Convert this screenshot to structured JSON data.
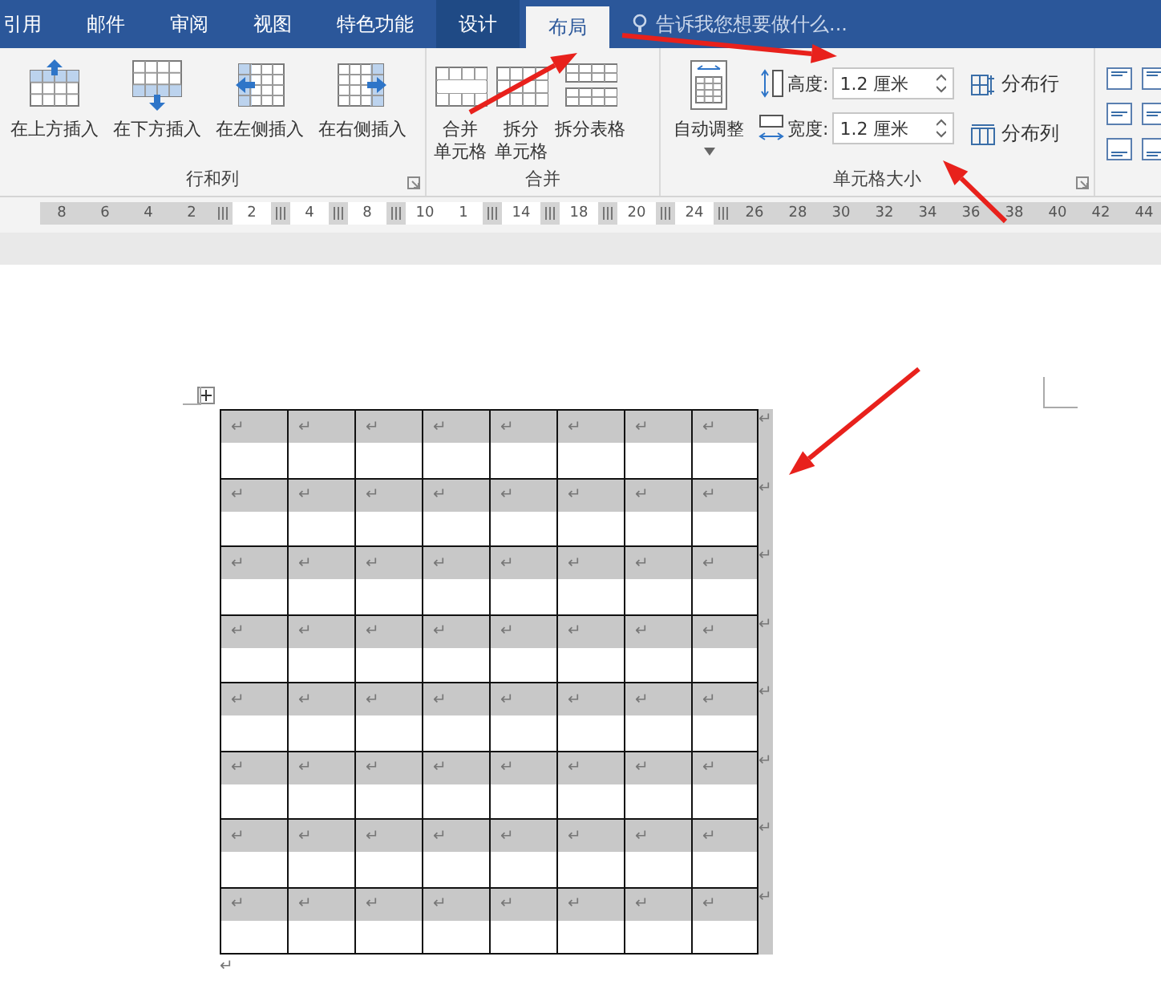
{
  "tabs": [
    {
      "label": "引用",
      "selected": false,
      "kind": "normal"
    },
    {
      "label": "邮件",
      "selected": false,
      "kind": "normal"
    },
    {
      "label": "审阅",
      "selected": false,
      "kind": "normal"
    },
    {
      "label": "视图",
      "selected": false,
      "kind": "normal"
    },
    {
      "label": "特色功能",
      "selected": false,
      "kind": "normal"
    },
    {
      "label": "设计",
      "selected": false,
      "kind": "contextual"
    },
    {
      "label": "布局",
      "selected": true,
      "kind": "contextual"
    }
  ],
  "tell_me": {
    "placeholder": "告诉我您想要做什么..."
  },
  "groups": [
    {
      "label": "行和列",
      "launcher": true,
      "items": [
        {
          "kind": "big-button",
          "label": "在上方插入"
        },
        {
          "kind": "big-button",
          "label": "在下方插入"
        },
        {
          "kind": "big-button",
          "label": "在左侧插入"
        },
        {
          "kind": "big-button",
          "label": "在右侧插入"
        }
      ]
    },
    {
      "label": "合并",
      "launcher": false,
      "items": [
        {
          "kind": "big-button",
          "lines": [
            "合并",
            "单元格"
          ]
        },
        {
          "kind": "big-button",
          "lines": [
            "拆分",
            "单元格"
          ]
        },
        {
          "kind": "big-button",
          "label": "拆分表格"
        }
      ]
    },
    {
      "label": "单元格大小",
      "launcher": true,
      "items": [
        {
          "kind": "dropdown-button",
          "label": "自动调整"
        },
        {
          "kind": "size-fields",
          "fields": [
            {
              "label": "高度:",
              "value": "1.2 厘米"
            },
            {
              "label": "宽度:",
              "value": "1.2 厘米"
            }
          ]
        },
        {
          "kind": "small-buttons",
          "buttons": [
            {
              "label": "分布行"
            },
            {
              "label": "分布列"
            }
          ]
        }
      ]
    },
    {
      "items": [
        {
          "kind": "align-grid"
        }
      ]
    }
  ],
  "ruler": [
    {
      "kind": "margin",
      "text": "8"
    },
    {
      "kind": "margin",
      "text": "6"
    },
    {
      "kind": "margin",
      "text": "4"
    },
    {
      "kind": "margin",
      "text": "2"
    },
    {
      "kind": "marker"
    },
    {
      "kind": "body",
      "text": "2"
    },
    {
      "kind": "marker"
    },
    {
      "kind": "body",
      "text": "4"
    },
    {
      "kind": "marker"
    },
    {
      "kind": "body",
      "text": "8"
    },
    {
      "kind": "marker"
    },
    {
      "kind": "body",
      "text": "10"
    },
    {
      "kind": "body",
      "text": "1"
    },
    {
      "kind": "marker"
    },
    {
      "kind": "body",
      "text": "14"
    },
    {
      "kind": "marker"
    },
    {
      "kind": "body",
      "text": "18"
    },
    {
      "kind": "marker"
    },
    {
      "kind": "body",
      "text": "20"
    },
    {
      "kind": "marker"
    },
    {
      "kind": "body",
      "text": "24"
    },
    {
      "kind": "marker"
    },
    {
      "kind": "margin",
      "text": "26"
    },
    {
      "kind": "margin",
      "text": "28"
    },
    {
      "kind": "margin",
      "text": "30"
    },
    {
      "kind": "margin",
      "text": "32"
    },
    {
      "kind": "margin",
      "text": "34"
    },
    {
      "kind": "margin",
      "text": "36"
    },
    {
      "kind": "margin",
      "text": "38"
    },
    {
      "kind": "margin",
      "text": "40"
    },
    {
      "kind": "margin",
      "text": "42"
    },
    {
      "kind": "margin",
      "text": "44"
    }
  ],
  "table": {
    "selected": true,
    "rows": [
      {
        "cells": [
          "↵",
          "↵",
          "↵",
          "↵",
          "↵",
          "↵",
          "↵",
          "↵"
        ],
        "end_mark": "↵"
      },
      {
        "cells": [
          "↵",
          "↵",
          "↵",
          "↵",
          "↵",
          "↵",
          "↵",
          "↵"
        ],
        "end_mark": "↵"
      },
      {
        "cells": [
          "↵",
          "↵",
          "↵",
          "↵",
          "↵",
          "↵",
          "↵",
          "↵"
        ],
        "end_mark": "↵"
      },
      {
        "cells": [
          "↵",
          "↵",
          "↵",
          "↵",
          "↵",
          "↵",
          "↵",
          "↵"
        ],
        "end_mark": "↵"
      },
      {
        "cells": [
          "↵",
          "↵",
          "↵",
          "↵",
          "↵",
          "↵",
          "↵",
          "↵"
        ],
        "end_mark": "↵"
      },
      {
        "cells": [
          "↵",
          "↵",
          "↵",
          "↵",
          "↵",
          "↵",
          "↵",
          "↵"
        ],
        "end_mark": "↵"
      },
      {
        "cells": [
          "↵",
          "↵",
          "↵",
          "↵",
          "↵",
          "↵",
          "↵",
          "↵"
        ],
        "end_mark": "↵"
      },
      {
        "cells": [
          "↵",
          "↵",
          "↵",
          "↵",
          "↵",
          "↵",
          "↵",
          "↵"
        ],
        "end_mark": "↵"
      }
    ]
  },
  "after_table_mark": "↵"
}
